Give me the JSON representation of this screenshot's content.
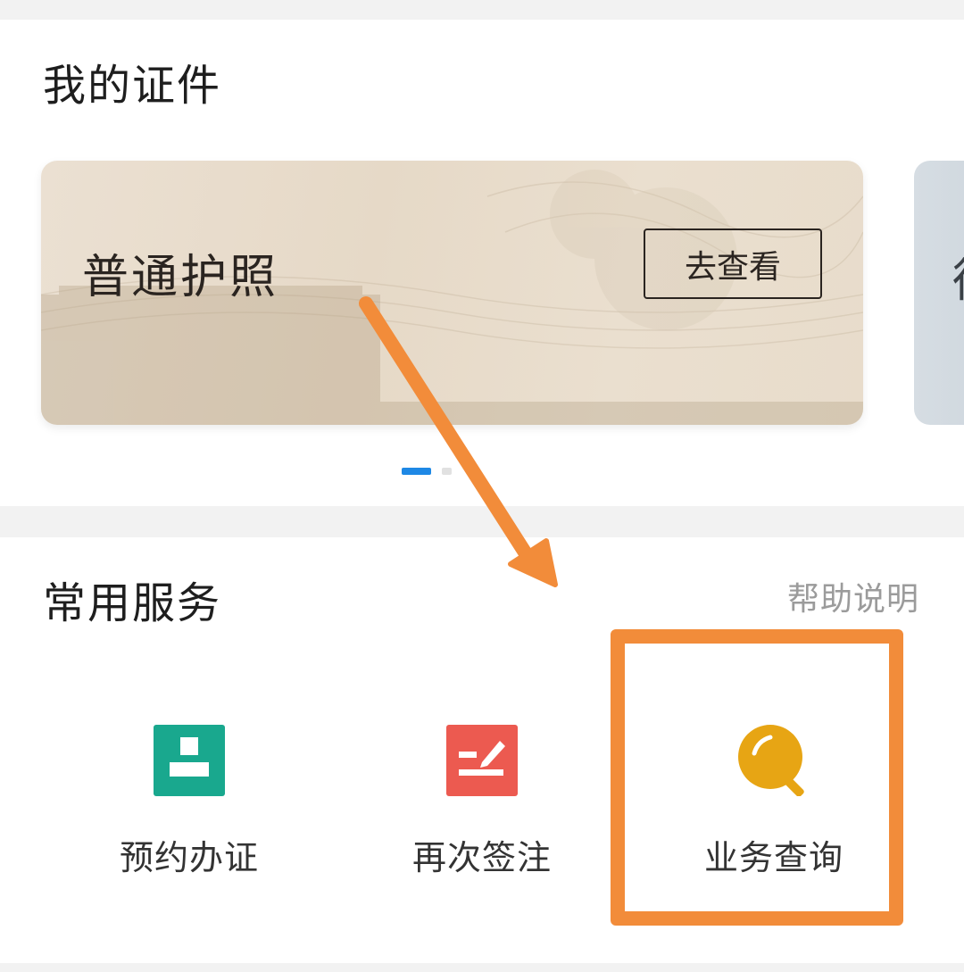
{
  "documents": {
    "title": "我的证件",
    "card": {
      "title": "普通护照",
      "button_label": "去查看"
    },
    "next_card_glyph": "徨",
    "carousel": {
      "active_index": 0,
      "count": 2
    }
  },
  "services": {
    "title": "常用服务",
    "help_label": "帮助说明",
    "items": [
      {
        "label": "预约办证",
        "icon": "id-card-icon",
        "color": "#19a88e"
      },
      {
        "label": "再次签注",
        "icon": "sign-pen-icon",
        "color": "#ec5a50"
      },
      {
        "label": "业务查询",
        "icon": "search-icon",
        "color": "#e7a514"
      }
    ]
  },
  "annotations": {
    "arrow_color": "#f28c3a",
    "highlight_color": "#f28c3a"
  }
}
